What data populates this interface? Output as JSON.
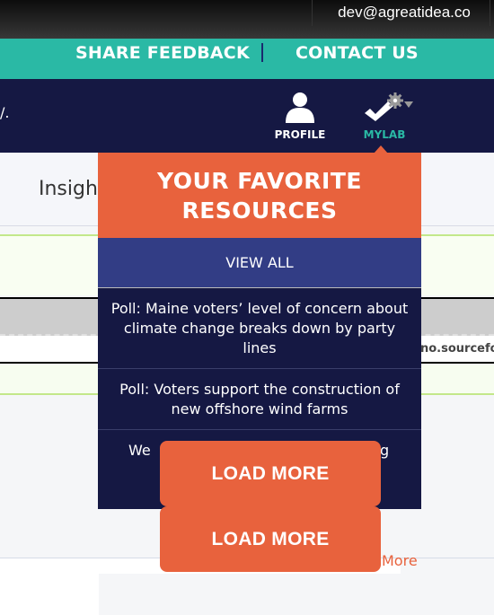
{
  "topbar": {
    "user_email": "dev@agreatidea.co"
  },
  "utility_nav": {
    "share_feedback": "SHARE FEEDBACK",
    "contact_us": "CONTACT US"
  },
  "header": {
    "truncated_text": "/.",
    "profile_label": "PROFILE",
    "mylab_label": "MYLAB",
    "icons": {
      "profile": "person-icon",
      "mylab": "checkmark-gear-icon",
      "dropdown": "caret-down-icon"
    }
  },
  "background": {
    "insights_tab": "Insigh",
    "source_fragment": "no.sourcefo",
    "more_link": "More"
  },
  "favorites_dropdown": {
    "title": "YOUR FAVORITE RESOURCES",
    "view_all": "VIEW ALL",
    "items": [
      {
        "title": "Poll: Maine voters’ level of concern about climate change breaks down by party lines"
      },
      {
        "title": "Poll: Voters support the construction of new offshore wind farms"
      },
      {
        "title_start": "We",
        "title_end": "g"
      }
    ]
  },
  "buttons": {
    "load_more_1": "LOAD MORE",
    "load_more_2": "LOAD MORE"
  },
  "colors": {
    "teal": "#2ab9a5",
    "navy": "#151843",
    "orange": "#e8623d",
    "indigo": "#323d85"
  }
}
